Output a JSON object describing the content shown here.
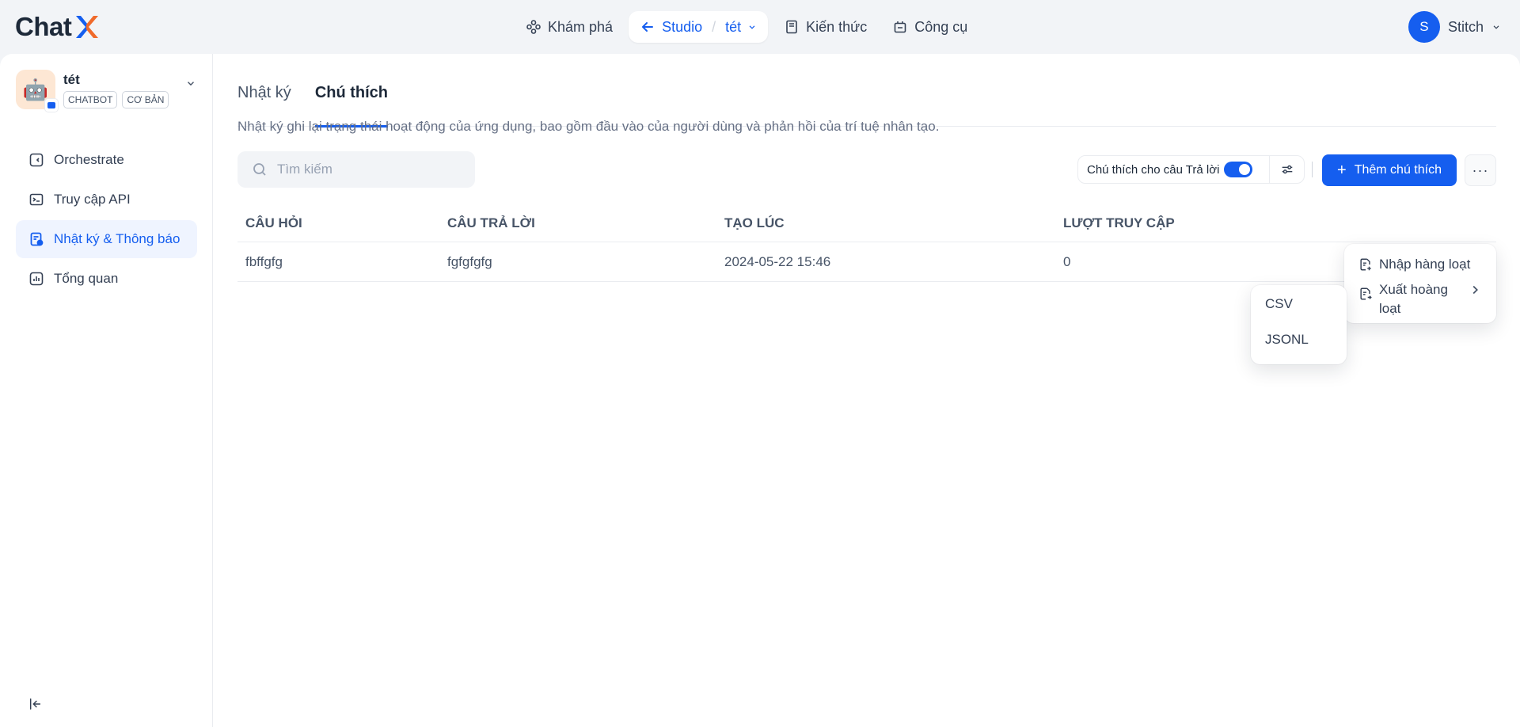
{
  "header": {
    "logo_text": "Chat",
    "nav": [
      {
        "label": "Khám phá",
        "icon": "explore-icon"
      },
      {
        "label": "Studio",
        "icon": "arrow-left-icon",
        "app": "tét"
      },
      {
        "label": "Kiến thức",
        "icon": "book-icon"
      },
      {
        "label": "Công cụ",
        "icon": "tools-icon"
      }
    ],
    "user": {
      "initial": "S",
      "name": "Stitch"
    }
  },
  "sidebar": {
    "app": {
      "name": "tét",
      "tags": [
        "CHATBOT",
        "CƠ BẢN"
      ]
    },
    "items": [
      {
        "label": "Orchestrate",
        "icon": "orchestrate-icon"
      },
      {
        "label": "Truy cập API",
        "icon": "terminal-icon"
      },
      {
        "label": "Nhật ký & Thông báo",
        "icon": "logs-icon",
        "active": true
      },
      {
        "label": "Tổng quan",
        "icon": "chart-icon"
      }
    ]
  },
  "main": {
    "tabs": [
      {
        "label": "Nhật ký"
      },
      {
        "label": "Chú thích",
        "active": true
      }
    ],
    "description": "Nhật ký ghi lại trạng thái hoạt động của ứng dụng, bao gồm đầu vào của người dùng và phản hồi của trí tuệ nhân tạo.",
    "search": {
      "placeholder": "Tìm kiếm"
    },
    "toggle_label": "Chú thích cho câu Trả lời",
    "add_button": "Thêm chú thích",
    "table": {
      "headers": [
        "CÂU HỎI",
        "CÂU TRẢ LỜI",
        "TẠO LÚC",
        "LƯỢT TRUY CẬP"
      ],
      "rows": [
        {
          "question": "fbffgfg",
          "answer": "fgfgfgfg",
          "created": "2024-05-22 15:46",
          "hits": "0"
        }
      ]
    },
    "more_menu": {
      "import": "Nhập hàng loạt",
      "export": "Xuất hoàng loạt",
      "export_options": [
        "CSV",
        "JSONL"
      ]
    }
  },
  "colors": {
    "accent": "#155eef",
    "active_bg": "#eff4ff",
    "page_bg": "#f2f4f7"
  }
}
